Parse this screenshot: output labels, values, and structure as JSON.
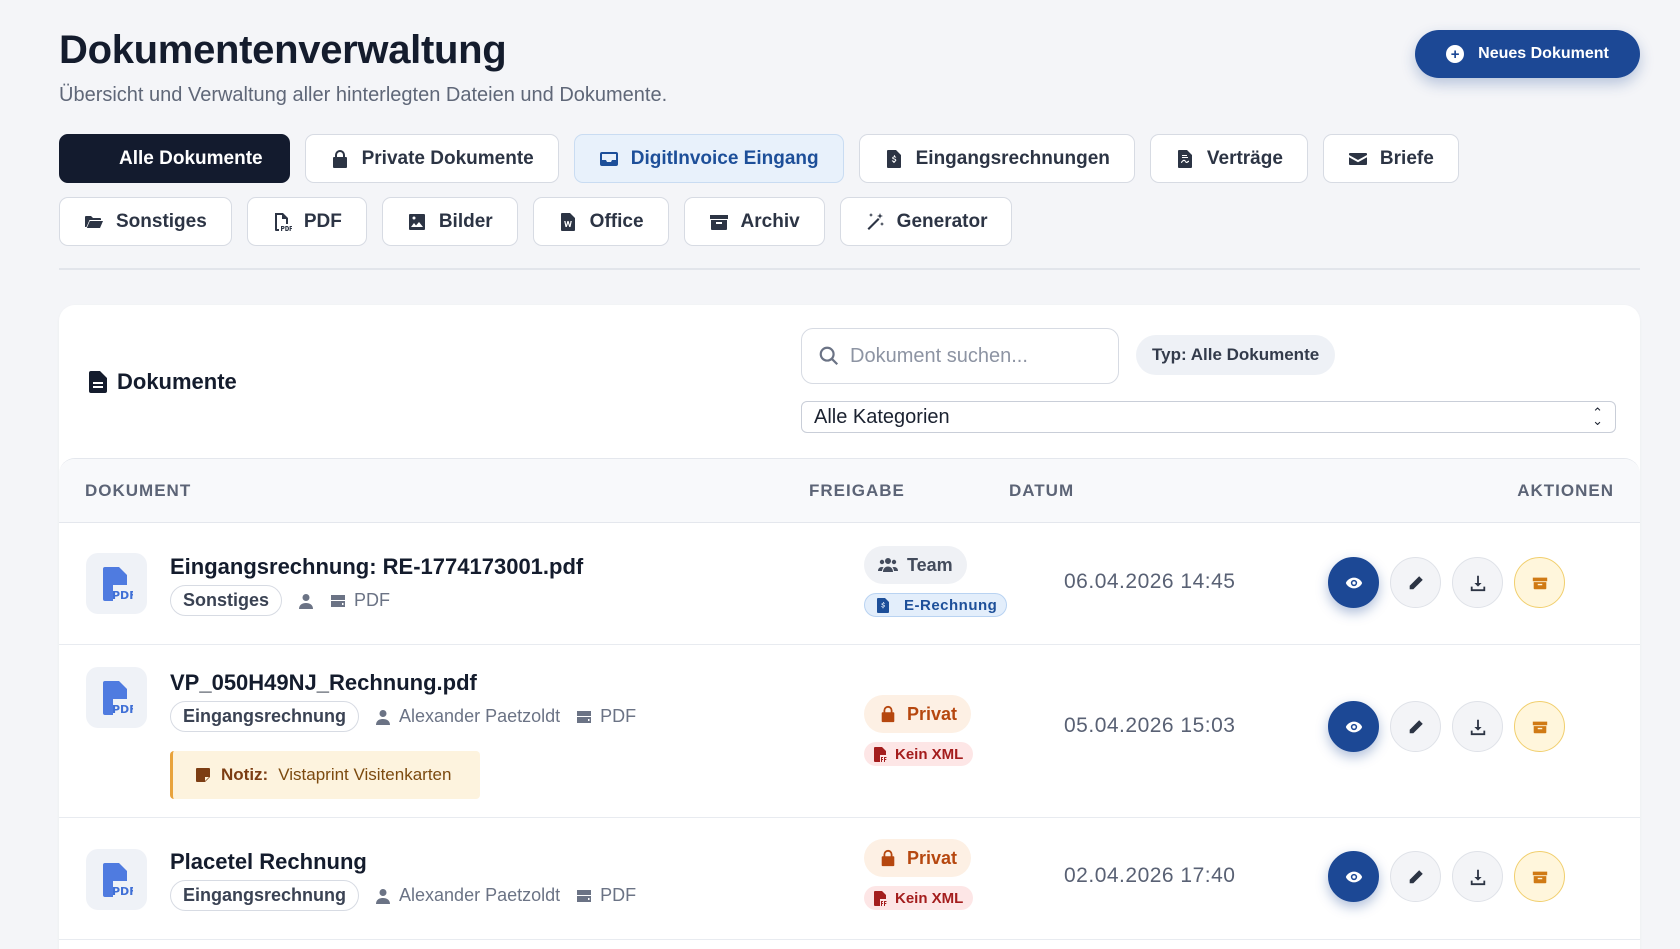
{
  "header": {
    "title": "Dokumentenverwaltung",
    "subtitle": "Übersicht und Verwaltung aller hinterlegten Dateien und Dokumente.",
    "new_button": "Neues Dokument"
  },
  "tabs": [
    {
      "label": "Alle Dokumente",
      "icon": "none"
    },
    {
      "label": "Private Dokumente",
      "icon": "lock-icon"
    },
    {
      "label": "DigitInvoice Eingang",
      "icon": "inbox-icon"
    },
    {
      "label": "Eingangsrechnungen",
      "icon": "invoice-icon"
    },
    {
      "label": "Verträge",
      "icon": "contract-icon"
    },
    {
      "label": "Briefe",
      "icon": "envelope-icon"
    },
    {
      "label": "Sonstiges",
      "icon": "folder-open-icon"
    },
    {
      "label": "PDF",
      "icon": "pdf-icon"
    },
    {
      "label": "Bilder",
      "icon": "image-icon"
    },
    {
      "label": "Office",
      "icon": "word-file-icon"
    },
    {
      "label": "Archiv",
      "icon": "archive-icon"
    },
    {
      "label": "Generator",
      "icon": "magic-wand-icon"
    }
  ],
  "active_tab": "Alle Dokumente",
  "documents_card": {
    "title": "Dokumente",
    "search_placeholder": "Dokument suchen...",
    "type_pill": "Typ: Alle Dokumente",
    "category_select": "Alle Kategorien"
  },
  "table": {
    "columns": [
      "DOKUMENT",
      "FREIGABE",
      "DATUM",
      "AKTIONEN"
    ],
    "rows": [
      {
        "name": "Eingangsrechnung: RE-1774173001.pdf",
        "category": "Sonstiges",
        "owner": "",
        "format": "PDF",
        "share": "Team",
        "badge": "E-Rechnung",
        "date": "06.04.2026 14:45",
        "note_label": "",
        "note_text": ""
      },
      {
        "name": "VP_050H49NJ_Rechnung.pdf",
        "category": "Eingangsrechnung",
        "owner": "Alexander Paetzoldt",
        "format": "PDF",
        "share": "Privat",
        "badge": "Kein XML",
        "date": "05.04.2026 15:03",
        "note_label": "Notiz:",
        "note_text": "Vistaprint Visitenkarten"
      },
      {
        "name": "Placetel Rechnung",
        "category": "Eingangsrechnung",
        "owner": "Alexander Paetzoldt",
        "format": "PDF",
        "share": "Privat",
        "badge": "Kein XML",
        "date": "02.04.2026 17:40",
        "note_label": "",
        "note_text": ""
      }
    ]
  },
  "colors": {
    "primary": "#1c4895",
    "dark_tab": "#131b2e",
    "private": "#b6470f",
    "archive": "#d07a14",
    "no_xml": "#a41d1d"
  }
}
